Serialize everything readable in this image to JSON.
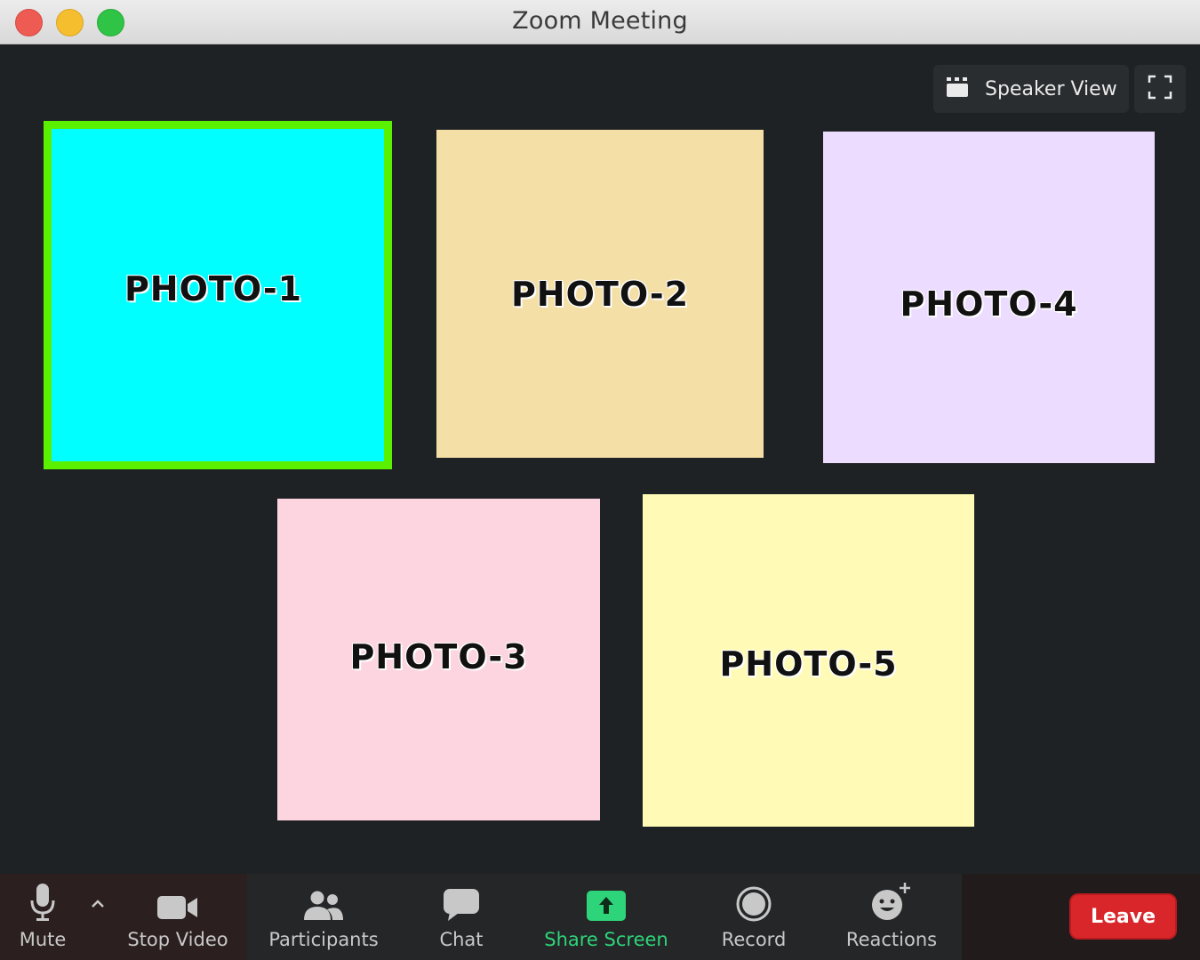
{
  "window": {
    "title": "Zoom Meeting"
  },
  "view_controls": {
    "speaker_view_label": "Speaker View"
  },
  "tiles": [
    {
      "label": "PHOTO-1",
      "color": "#00ffff",
      "active_speaker": true,
      "highlight_color": "#5af000"
    },
    {
      "label": "PHOTO-2",
      "color": "#f4dfa6"
    },
    {
      "label": "PHOTO-4",
      "color": "#ecdcff"
    },
    {
      "label": "PHOTO-3",
      "color": "#fcd5e0"
    },
    {
      "label": "PHOTO-5",
      "color": "#fffab6"
    }
  ],
  "toolbar": {
    "mute_label": "Mute",
    "stop_video_label": "Stop Video",
    "participants_label": "Participants",
    "chat_label": "Chat",
    "share_screen_label": "Share Screen",
    "record_label": "Record",
    "reactions_label": "Reactions",
    "leave_label": "Leave"
  },
  "icons": {
    "speaker_view": "grid-icon",
    "fullscreen": "fullscreen-icon",
    "mute": "microphone-icon",
    "audio_options": "chevron-up-icon",
    "video": "video-camera-icon",
    "participants": "people-icon",
    "chat": "chat-bubble-icon",
    "share": "share-screen-icon",
    "record": "record-icon",
    "reactions": "smiley-add-icon"
  },
  "colors": {
    "accent_share": "#2ed47a",
    "leave": "#d9262a",
    "background": "#1f2224"
  }
}
